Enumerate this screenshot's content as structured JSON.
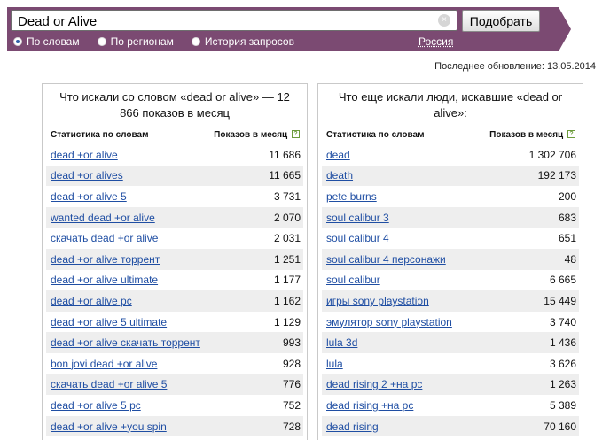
{
  "search": {
    "value": "Dead or Alive",
    "button_label": "Подобрать",
    "clear_symbol": "×",
    "radios": [
      {
        "label": "По словам",
        "selected": true
      },
      {
        "label": "По регионам",
        "selected": false
      },
      {
        "label": "История запросов",
        "selected": false
      }
    ],
    "region": "Россия"
  },
  "last_update": "Последнее обновление: 13.05.2014",
  "left_panel": {
    "title": "Что искали со словом «dead or alive» — 12 866 показов в месяц",
    "col_words": "Статистика по словам",
    "col_count": "Показов в месяц",
    "rows": [
      {
        "q": "dead +or alive",
        "n": "11 686"
      },
      {
        "q": "dead +or alives",
        "n": "11 665"
      },
      {
        "q": "dead +or alive 5",
        "n": "3 731"
      },
      {
        "q": "wanted dead +or alive",
        "n": "2 070"
      },
      {
        "q": "скачать dead +or alive",
        "n": "2 031"
      },
      {
        "q": "dead +or alive торрент",
        "n": "1 251"
      },
      {
        "q": "dead +or alive ultimate",
        "n": "1 177"
      },
      {
        "q": "dead +or alive pc",
        "n": "1 162"
      },
      {
        "q": "dead +or alive 5 ultimate",
        "n": "1 129"
      },
      {
        "q": "dead +or alive скачать торрент",
        "n": "993"
      },
      {
        "q": "bon jovi dead +or alive",
        "n": "928"
      },
      {
        "q": "скачать dead +or alive 5",
        "n": "776"
      },
      {
        "q": "dead +or alive 5 pc",
        "n": "752"
      },
      {
        "q": "dead +or alive +you spin",
        "n": "728"
      }
    ]
  },
  "right_panel": {
    "title": "Что еще искали люди, искавшие «dead or alive»:",
    "col_words": "Статистика по словам",
    "col_count": "Показов в месяц",
    "rows": [
      {
        "q": "dead",
        "n": "1 302 706"
      },
      {
        "q": "death",
        "n": "192 173"
      },
      {
        "q": "pete burns",
        "n": "200"
      },
      {
        "q": "soul calibur 3",
        "n": "683"
      },
      {
        "q": "soul calibur 4",
        "n": "651"
      },
      {
        "q": "soul calibur 4 персонажи",
        "n": "48"
      },
      {
        "q": "soul calibur",
        "n": "6 665"
      },
      {
        "q": "игры sony playstation",
        "n": "15 449"
      },
      {
        "q": "эмулятор sony playstation",
        "n": "3 740"
      },
      {
        "q": "lula 3d",
        "n": "1 436"
      },
      {
        "q": "lula",
        "n": "3 626"
      },
      {
        "q": "dead rising 2 +на pc",
        "n": "1 263"
      },
      {
        "q": "dead rising +на pc",
        "n": "5 389"
      },
      {
        "q": "dead rising",
        "n": "70 160"
      }
    ]
  },
  "colors": {
    "banner": "#7b4a72",
    "link": "#1f4ea3",
    "row_stripe": "#eeeeee",
    "help_icon": "#6c9b3c"
  }
}
